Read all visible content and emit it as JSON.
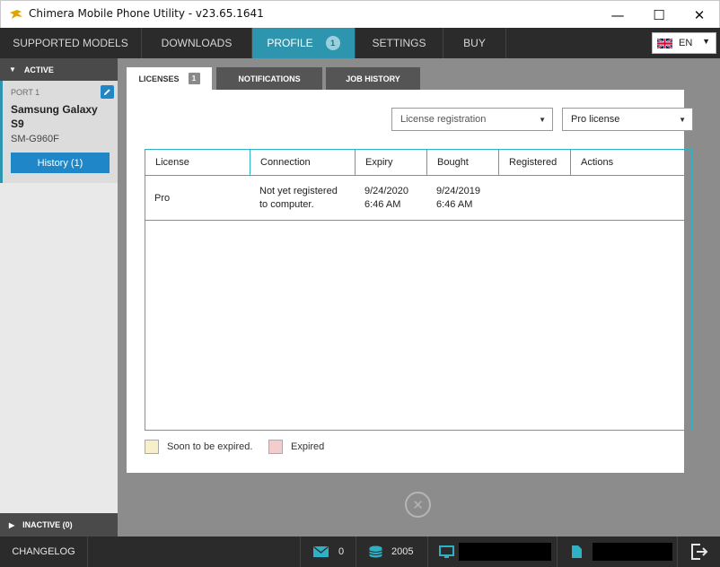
{
  "window": {
    "title": "Chimera Mobile Phone Utility - v23.65.1641",
    "minimize": "—",
    "maximize": "☐",
    "close": "✕"
  },
  "nav": {
    "tabs": [
      {
        "label": "SUPPORTED MODELS"
      },
      {
        "label": "DOWNLOADS"
      },
      {
        "label": "PROFILE",
        "badge": "1"
      },
      {
        "label": "SETTINGS"
      },
      {
        "label": "BUY"
      }
    ],
    "language": "EN"
  },
  "sidebar": {
    "active_label": "ACTIVE",
    "port_label": "PORT 1",
    "device_name": "Samsung Galaxy S9",
    "device_model": "SM-G960F",
    "history_button": "History (1)",
    "inactive_label": "INACTIVE (0)"
  },
  "subtabs": {
    "licenses": "LICENSES",
    "licenses_badge": "1",
    "notifications": "NOTIFICATIONS",
    "job_history": "JOB HISTORY"
  },
  "filters": {
    "registration_select": "License registration",
    "license_select": "Pro license"
  },
  "table": {
    "headers": [
      "License",
      "Connection",
      "Expiry",
      "Bought",
      "Registered",
      "Actions"
    ],
    "rows": [
      {
        "license": "Pro",
        "connection_line1": "Not yet registered",
        "connection_line2": "to computer.",
        "expiry_date": "9/24/2020",
        "expiry_time": "6:46 AM",
        "bought_date": "9/24/2019",
        "bought_time": "6:46 AM",
        "registered": "",
        "actions": ""
      }
    ]
  },
  "legend": {
    "soon_expired": "Soon to be expired.",
    "expired": "Expired",
    "soon_color": "#f7efc9",
    "expired_color": "#f4cccd"
  },
  "statusbar": {
    "changelog": "CHANGELOG",
    "messages": "0",
    "credits": "2005"
  },
  "colors": {
    "accent": "#2d95ad",
    "button_blue": "#1f86c8",
    "table_border": "#2fb1c5",
    "dark_bar": "#2b2b2b"
  }
}
